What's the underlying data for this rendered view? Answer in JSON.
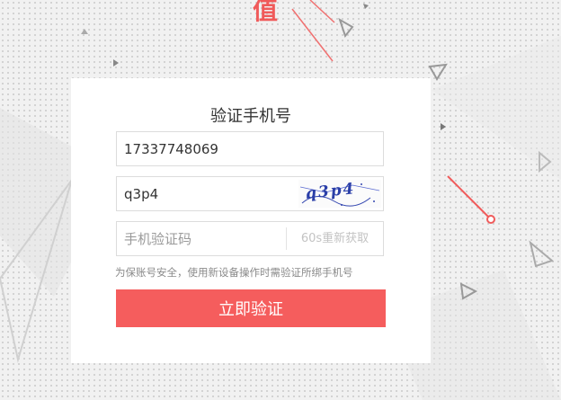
{
  "brand": {
    "char": "值",
    "accent_color": "#f55d5d"
  },
  "card": {
    "title": "验证手机号",
    "phone": {
      "value": "17337748069"
    },
    "captcha": {
      "value": "q3p4",
      "image_text": "q3p4"
    },
    "sms_code": {
      "placeholder": "手机验证码",
      "resend_label": "60s重新获取"
    },
    "hint": "为保账号安全，使用新设备操作时需验证所绑手机号",
    "submit_label": "立即验证"
  }
}
